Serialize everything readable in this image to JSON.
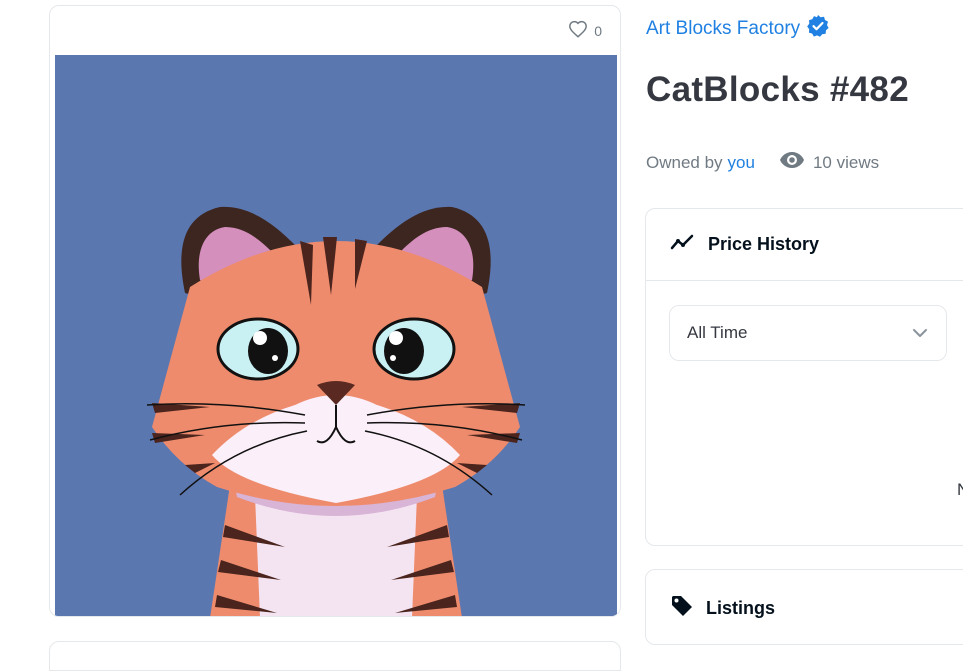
{
  "item": {
    "favorite_count": "0",
    "collection": "Art Blocks Factory",
    "title": "CatBlocks #482",
    "owned_by_label": "Owned by",
    "owner": "you",
    "views": "10 views"
  },
  "price_history": {
    "heading": "Price History",
    "period_selected": "All Time",
    "partial_text": "N"
  },
  "listings": {
    "heading": "Listings"
  },
  "icons": {
    "favorite": "heart-outline-icon",
    "verified": "verified-badge-icon",
    "views": "eye-icon",
    "price_history": "trending-line-icon",
    "select": "chevron-down-icon",
    "listings": "tag-icon"
  },
  "colors": {
    "link_blue": "#2081e2",
    "artwork_background": "#5b77b0",
    "cat_orange": "#ee8b6d",
    "stripe_brown": "#4a241d"
  }
}
